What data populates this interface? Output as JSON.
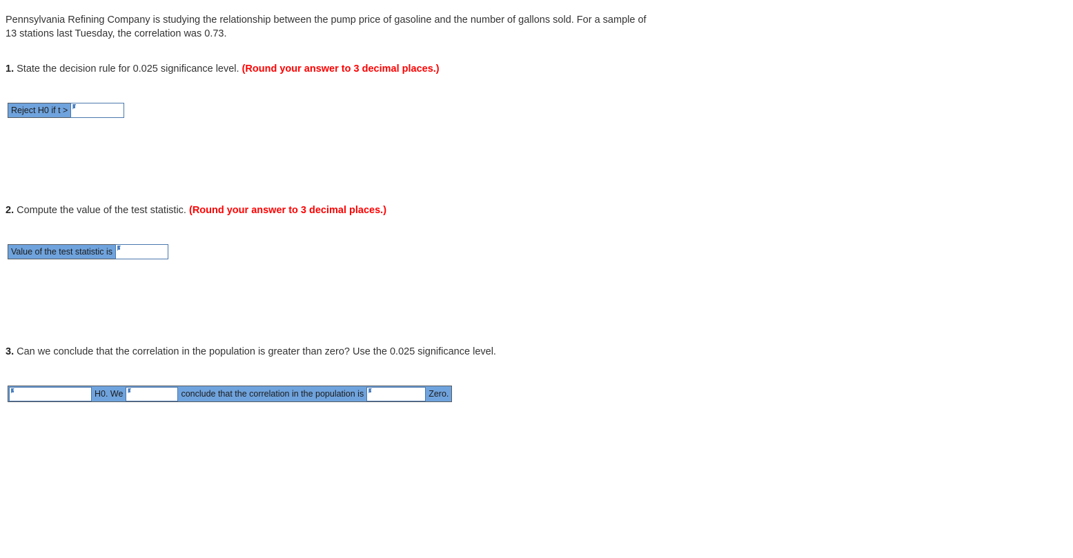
{
  "problem": {
    "intro": "Pennsylvania Refining Company is studying the relationship between the pump price of gasoline and the number of gallons sold. For a sample of 13 stations last Tuesday, the correlation was 0.73."
  },
  "questions": [
    {
      "number": "1.",
      "prompt": "State the decision rule for 0.025 significance level.",
      "note": "(Round your answer to 3 decimal places.)",
      "answer": {
        "label": "Reject H0 if t >",
        "input_value": "",
        "input_placeholder": ""
      }
    },
    {
      "number": "2.",
      "prompt": "Compute the value of the test statistic.",
      "note": "(Round your answer to 3 decimal places.)",
      "answer": {
        "label": "Value of the test statistic is",
        "input_value": "",
        "input_placeholder": ""
      }
    },
    {
      "number": "3.",
      "prompt": "Can we conclude that the correlation in the population is greater than zero? Use the 0.025 significance level.",
      "note": "",
      "answer": {
        "select1_value": "",
        "text1": "H0. We",
        "select2_value": "",
        "text2": "conclude that the correlation in the population is",
        "select3_value": "",
        "text3": "Zero."
      }
    }
  ],
  "colors": {
    "widget_blue": "#6fa3dd",
    "note_red": "#ff0000",
    "text_gray": "#333333",
    "field_border": "#4a77ad",
    "tag_border": "#555a60"
  }
}
